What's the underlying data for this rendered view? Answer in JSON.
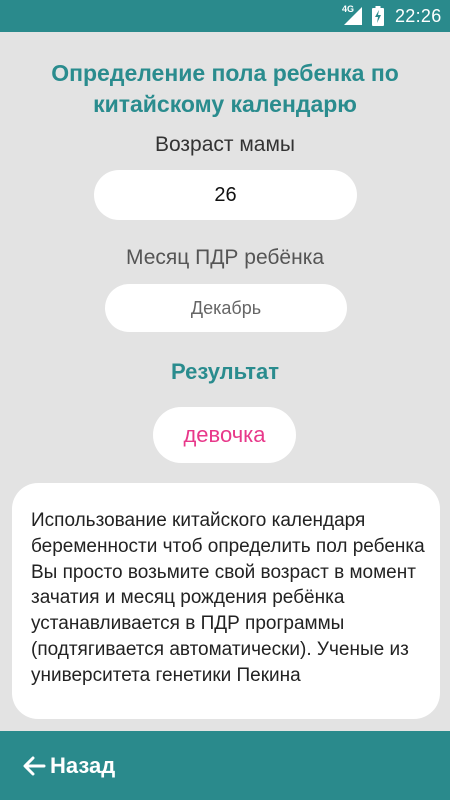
{
  "status_bar": {
    "network": "4G",
    "time": "22:26",
    "icons": [
      "signal-icon",
      "battery-charging-icon"
    ]
  },
  "page": {
    "title_line1": "Определение пола ребенка по",
    "title_line2": "китайскому календарю"
  },
  "mother_age": {
    "label": "Возраст мамы",
    "value": "26"
  },
  "due_month": {
    "label": "Месяц ПДР ребёнка",
    "value": "Декабрь"
  },
  "result": {
    "heading": "Результат",
    "value": "девочка"
  },
  "description": {
    "text": "Использование китайского календаря беременности чтоб определить пол ребенка Вы просто возьмите свой возраст в момент зачатия и месяц рождения ребёнка устанавливается в ПДР программы (подтягивается автоматически). Ученые из университета генетики Пекина"
  },
  "bottom_bar": {
    "back_label": "Назад",
    "back_icon": "arrow-left-icon"
  },
  "colors": {
    "accent": "#2a8a8c",
    "background": "#e3e3e3",
    "result_text": "#e8388a"
  }
}
